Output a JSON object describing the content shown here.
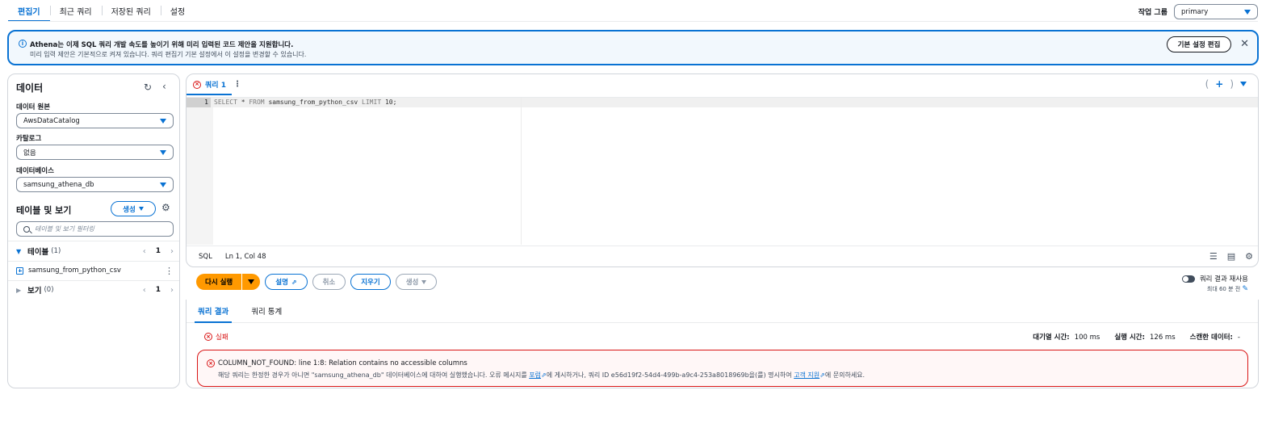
{
  "top_tabs": [
    "편집기",
    "최근 쿼리",
    "저장된 쿼리",
    "설정"
  ],
  "workgroup": {
    "label": "작업 그룹",
    "value": "primary"
  },
  "banner": {
    "title": "Athena는 이제 SQL 쿼리 개발 속도를 높이기 위해 미리 입력된 코드 제안을 지원합니다.",
    "body": "미리 입력 제안은 기본적으로 켜져 있습니다. 쿼리 편집기 기본 설정에서 이 설정을 변경할 수 있습니다.",
    "button": "기본 설정 편집",
    "close": "✕"
  },
  "left": {
    "title": "데이터",
    "datasource_label": "데이터 원본",
    "datasource_value": "AwsDataCatalog",
    "catalog_label": "카탈로그",
    "catalog_value": "없음",
    "database_label": "데이터베이스",
    "database_value": "samsung_athena_db",
    "tables_views_title": "테이블 및 보기",
    "create_button": "생성",
    "filter_placeholder": "테이블 및 보기 필터링",
    "tables_label": "테이블",
    "tables_count": "(1)",
    "tables_page": "1",
    "table_item": "samsung_from_python_csv",
    "views_label": "보기",
    "views_count": "(0)",
    "views_page": "1"
  },
  "editor": {
    "tab_label": "쿼리 1",
    "line_number": "1",
    "code": {
      "kw1": "SELECT",
      "star": " * ",
      "kw2": "FROM",
      "table": " samsung_from_python_csv ",
      "kw3": "LIMIT",
      "end": " 10;"
    },
    "status_lang": "SQL",
    "status_pos": "Ln 1, Col 48"
  },
  "actions": {
    "run": "다시 실행",
    "explain": "설명",
    "cancel": "취소",
    "clear": "지우기",
    "create": "생성",
    "reuse_label": "쿼리 결과 재사용",
    "reuse_sub": "최대 60 분 전"
  },
  "results": {
    "tabs": [
      "쿼리 결과",
      "쿼리 통계"
    ],
    "status": "실패",
    "queue_label": "대기열 시간:",
    "queue_value": "100 ms",
    "run_label": "실행 시간:",
    "run_value": "126 ms",
    "scanned_label": "스캔한 데이터:",
    "scanned_value": "-",
    "error_title": "COLUMN_NOT_FOUND: line 1:8: Relation contains no accessible columns",
    "error_msg_1": "해당 쿼리는 한정한 경우가 아니면 \"samsung_athena_db\" 데이터베이스에 대하여 실행했습니다. 오류 메시지를 ",
    "error_link_1": "포럼",
    "error_msg_2": "에 게시하거나, 쿼리 ID e56d19f2-54d4-499b-a9c4-253a8018969b을(를) 명시하여 ",
    "error_link_2": "고객 지원",
    "error_msg_3": "에 문의하세요."
  },
  "colors": {
    "accent": "#0972d3",
    "run": "#ff9900",
    "error": "#d91515"
  }
}
